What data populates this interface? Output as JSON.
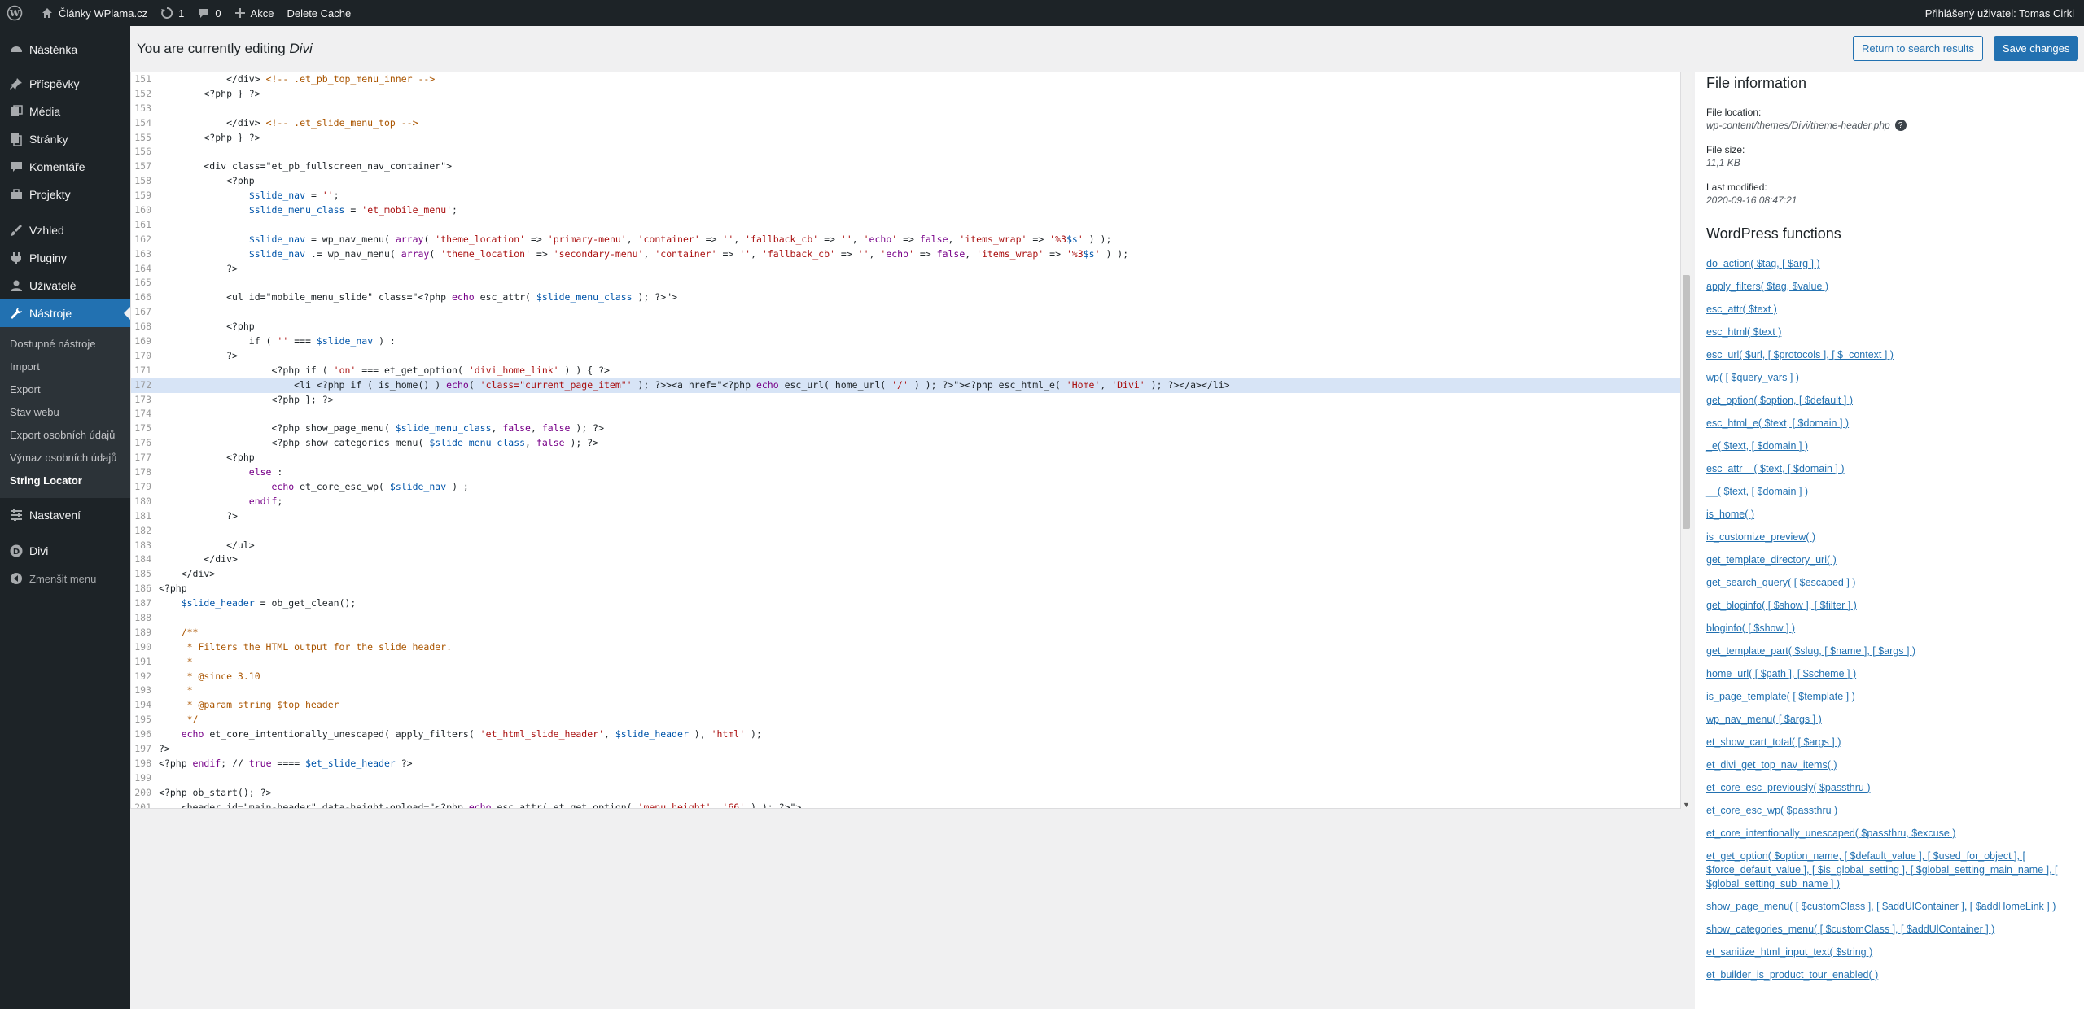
{
  "adminbar": {
    "site_name": "Články WPlama.cz",
    "updates_count": "1",
    "comments_count": "0",
    "new_label": "Akce",
    "delete_cache": "Delete Cache",
    "user_greeting": "Přihlášený uživatel: Tomas Cirkl"
  },
  "sidebar": {
    "items": [
      {
        "label": "Nástěnka",
        "icon": "dashboard-icon"
      },
      {
        "label": "Příspěvky",
        "icon": "pin-icon"
      },
      {
        "label": "Média",
        "icon": "media-icon"
      },
      {
        "label": "Stránky",
        "icon": "page-icon"
      },
      {
        "label": "Komentáře",
        "icon": "comment-icon"
      },
      {
        "label": "Projekty",
        "icon": "portfolio-icon"
      },
      {
        "label": "Vzhled",
        "icon": "brush-icon"
      },
      {
        "label": "Pluginy",
        "icon": "plugin-icon"
      },
      {
        "label": "Uživatelé",
        "icon": "users-icon"
      },
      {
        "label": "Nástroje",
        "icon": "tools-icon"
      }
    ],
    "submenu": [
      "Dostupné nástroje",
      "Import",
      "Export",
      "Stav webu",
      "Export osobních údajů",
      "Výmaz osobních údajů",
      "String Locator"
    ],
    "after": [
      {
        "label": "Nastavení",
        "icon": "settings-icon"
      },
      {
        "label": "Divi",
        "icon": "divi-icon"
      }
    ],
    "collapse": "Zmenšit menu"
  },
  "header": {
    "editing_prefix": "You are currently editing",
    "editing_target": "Divi",
    "return_button": "Return to search results",
    "save_button": "Save changes"
  },
  "editor": {
    "active_line": 172,
    "lines": [
      [
        "151",
        "            </div> <!-- .et_pb_top_menu_inner -->"
      ],
      [
        "152",
        "        <?php } ?>"
      ],
      [
        "153",
        ""
      ],
      [
        "154",
        "            </div> <!-- .et_slide_menu_top -->"
      ],
      [
        "155",
        "        <?php } ?>"
      ],
      [
        "156",
        ""
      ],
      [
        "157",
        "        <div class=\"et_pb_fullscreen_nav_container\">"
      ],
      [
        "158",
        "            <?php"
      ],
      [
        "159",
        "                $slide_nav = '';"
      ],
      [
        "160",
        "                $slide_menu_class = 'et_mobile_menu';"
      ],
      [
        "161",
        ""
      ],
      [
        "162",
        "                $slide_nav = wp_nav_menu( array( 'theme_location' => 'primary-menu', 'container' => '', 'fallback_cb' => '', 'echo' => false, 'items_wrap' => '%3$s' ) );"
      ],
      [
        "163",
        "                $slide_nav .= wp_nav_menu( array( 'theme_location' => 'secondary-menu', 'container' => '', 'fallback_cb' => '', 'echo' => false, 'items_wrap' => '%3$s' ) );"
      ],
      [
        "164",
        "            ?>"
      ],
      [
        "165",
        ""
      ],
      [
        "166",
        "            <ul id=\"mobile_menu_slide\" class=\"<?php echo esc_attr( $slide_menu_class ); ?>\">"
      ],
      [
        "167",
        ""
      ],
      [
        "168",
        "            <?php"
      ],
      [
        "169",
        "                if ( '' === $slide_nav ) :"
      ],
      [
        "170",
        "            ?>"
      ],
      [
        "171",
        "                    <?php if ( 'on' === et_get_option( 'divi_home_link' ) ) { ?>"
      ],
      [
        "172",
        "                        <li <?php if ( is_home() ) echo( 'class=\"current_page_item\"' ); ?>><a href=\"<?php echo esc_url( home_url( '/' ) ); ?>\"><?php esc_html_e( 'Home', 'Divi' ); ?></a></li>"
      ],
      [
        "173",
        "                    <?php }; ?>"
      ],
      [
        "174",
        ""
      ],
      [
        "175",
        "                    <?php show_page_menu( $slide_menu_class, false, false ); ?>"
      ],
      [
        "176",
        "                    <?php show_categories_menu( $slide_menu_class, false ); ?>"
      ],
      [
        "177",
        "            <?php"
      ],
      [
        "178",
        "                else :"
      ],
      [
        "179",
        "                    echo et_core_esc_wp( $slide_nav ) ;"
      ],
      [
        "180",
        "                endif;"
      ],
      [
        "181",
        "            ?>"
      ],
      [
        "182",
        ""
      ],
      [
        "183",
        "            </ul>"
      ],
      [
        "184",
        "        </div>"
      ],
      [
        "185",
        "    </div>"
      ],
      [
        "186",
        "<?php"
      ],
      [
        "187",
        "    $slide_header = ob_get_clean();"
      ],
      [
        "188",
        ""
      ],
      [
        "189",
        "    /**"
      ],
      [
        "190",
        "     * Filters the HTML output for the slide header."
      ],
      [
        "191",
        "     *"
      ],
      [
        "192",
        "     * @since 3.10"
      ],
      [
        "193",
        "     *"
      ],
      [
        "194",
        "     * @param string $top_header"
      ],
      [
        "195",
        "     */"
      ],
      [
        "196",
        "    echo et_core_intentionally_unescaped( apply_filters( 'et_html_slide_header', $slide_header ), 'html' );"
      ],
      [
        "197",
        "?>"
      ],
      [
        "198",
        "<?php endif; // true ==== $et_slide_header ?>"
      ],
      [
        "199",
        ""
      ],
      [
        "200",
        "<?php ob_start(); ?>"
      ],
      [
        "201",
        "    <header id=\"main-header\" data-height-onload=\"<?php echo esc_attr( et_get_option( 'menu_height', '66' ) ); ?>\">"
      ]
    ]
  },
  "file_info": {
    "heading": "File information",
    "location_label": "File location:",
    "location_value": "wp-content/themes/Divi/theme-header.php",
    "size_label": "File size:",
    "size_value": "11,1 KB",
    "modified_label": "Last modified:",
    "modified_value": "2020-09-16 08:47:21"
  },
  "functions": {
    "heading": "WordPress functions",
    "items": [
      "do_action( $tag, [ $arg ] )",
      "apply_filters( $tag, $value )",
      "esc_attr( $text )",
      "esc_html( $text )",
      "esc_url( $url, [ $protocols ], [ $_context ] )",
      "wp( [ $query_vars ] )",
      "get_option( $option, [ $default ] )",
      "esc_html_e( $text, [ $domain ] )",
      "_e( $text, [ $domain ] )",
      "esc_attr__( $text, [ $domain ] )",
      "__( $text, [ $domain ] )",
      "is_home( )",
      "is_customize_preview( )",
      "get_template_directory_uri( )",
      "get_search_query( [ $escaped ] )",
      "get_bloginfo( [ $show ], [ $filter ] )",
      "bloginfo( [ $show ] )",
      "get_template_part( $slug, [ $name ], [ $args ] )",
      "home_url( [ $path ], [ $scheme ] )",
      "is_page_template( [ $template ] )",
      "wp_nav_menu( [ $args ] )",
      "et_show_cart_total( [ $args ] )",
      "et_divi_get_top_nav_items( )",
      "et_core_esc_previously( $passthru )",
      "et_core_esc_wp( $passthru )",
      "et_core_intentionally_unescaped( $passthru, $excuse )",
      "et_get_option( $option_name, [ $default_value ], [ $used_for_object ], [ $force_default_value ], [ $is_global_setting ], [ $global_setting_main_name ], [ $global_setting_sub_name ] )",
      "show_page_menu( [ $customClass ], [ $addUlContainer ], [ $addHomeLink ] )",
      "show_categories_menu( [ $customClass ], [ $addUlContainer ] )",
      "et_sanitize_html_input_text( $string )",
      "et_builder_is_product_tour_enabled( )"
    ]
  }
}
